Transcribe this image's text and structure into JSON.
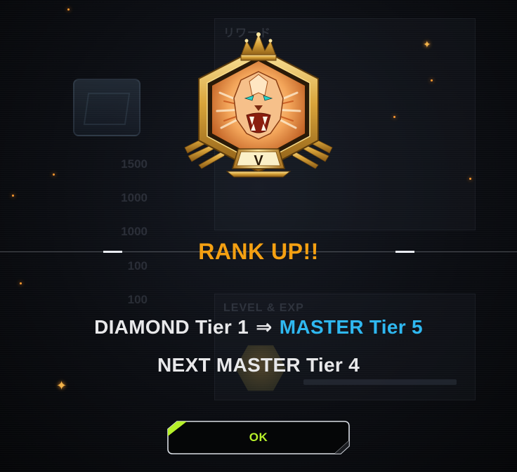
{
  "background": {
    "rewards_label": "リワード",
    "level_exp_label": "LEVEL & EXP",
    "reward_values": [
      "1500",
      "1000",
      "1000",
      "100",
      "100"
    ]
  },
  "emblem": {
    "tier_numeral": "V",
    "colors": {
      "gold": "#d9a43a",
      "gold_light": "#f6dc8c",
      "lion_orange": "#f08a3a",
      "lion_eyes": "#27d3c8"
    }
  },
  "dialog": {
    "title": "RANK UP!!",
    "from_rank": "DIAMOND Tier 1",
    "arrow": "⇒",
    "to_rank": "MASTER Tier 5",
    "next_rank": "NEXT MASTER Tier 4",
    "ok_label": "OK"
  },
  "colors": {
    "title": "#f4a012",
    "to_rank": "#2fb8f0",
    "text": "#e8e8ea",
    "ok_text": "#b6f02a",
    "ok_accent": "#b6f02a"
  }
}
